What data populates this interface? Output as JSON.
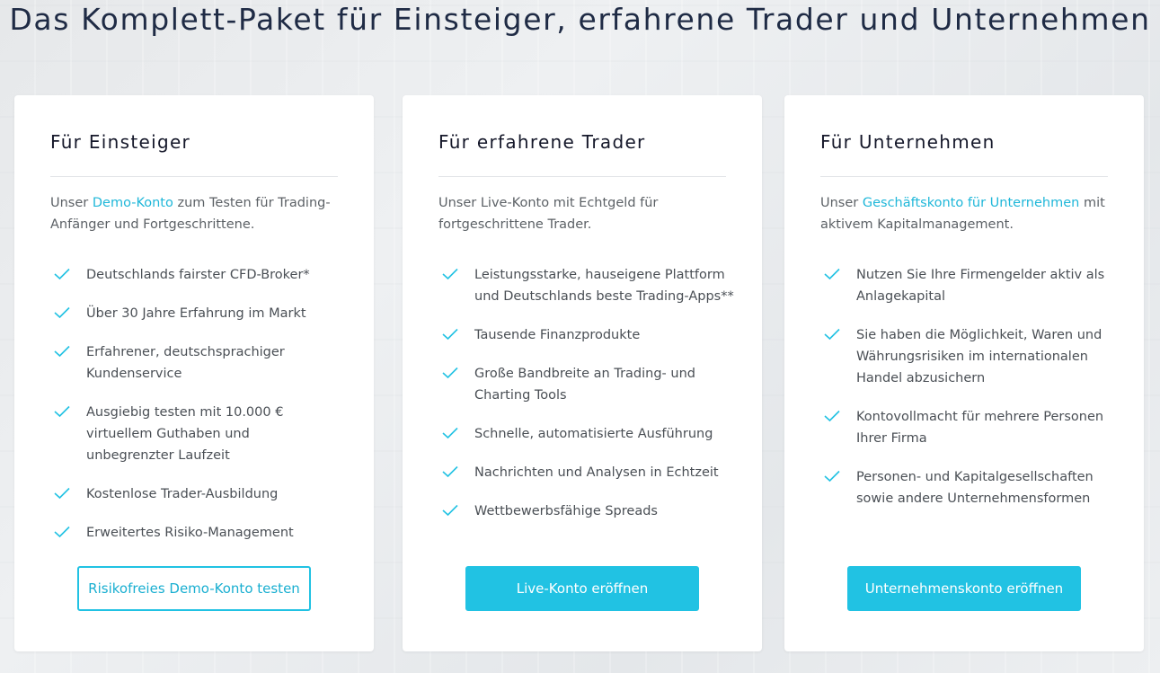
{
  "headline": "Das Komplett-Paket für Einsteiger, erfahrene Trader und Unternehmen",
  "colors": {
    "accent": "#21c2e3",
    "link": "#1fb7d9",
    "headline": "#1f2b45"
  },
  "cards": [
    {
      "title": "Für Einsteiger",
      "desc_prefix": "Unser ",
      "desc_link": "Demo-Konto",
      "desc_suffix": " zum Testen für Trading-Anfänger und Fortgeschrittene.",
      "features": [
        "Deutschlands fairster CFD-Broker*",
        "Über 30 Jahre Erfahrung im Markt",
        "Erfahrener, deutschsprachiger Kundenservice",
        "Ausgiebig testen mit 10.000 € virtuellem Guthaben und unbegrenzter Laufzeit",
        "Kostenlose Trader-Ausbildung",
        "Erweitertes Risiko-Management"
      ],
      "button": "Risikofreies Demo-Konto testen"
    },
    {
      "title": "Für erfahrene Trader",
      "desc_prefix": "Unser Live-Konto mit Echtgeld für fortgeschrittene Trader.",
      "desc_link": "",
      "desc_suffix": "",
      "features": [
        "Leistungsstarke, hauseigene Plattform und Deutschlands beste Trading-Apps**",
        "Tausende Finanzprodukte",
        "Große Bandbreite an Trading- und Charting Tools",
        "Schnelle, automatisierte Ausführung",
        "Nachrichten und Analysen in Echtzeit",
        "Wettbewerbsfähige Spreads"
      ],
      "button": "Live-Konto eröffnen"
    },
    {
      "title": "Für Unternehmen",
      "desc_prefix": "Unser ",
      "desc_link": "Geschäftskonto für Unternehmen",
      "desc_suffix": " mit aktivem Kapitalmanagement.",
      "features": [
        "Nutzen Sie Ihre Firmengelder aktiv als Anlagekapital",
        "Sie haben die Möglichkeit, Waren und Währungsrisiken im internationalen Handel abzusichern",
        "Kontovollmacht für mehrere Personen Ihrer Firma",
        "Personen- und Kapitalgesellschaften sowie andere Unternehmensformen"
      ],
      "button": "Unternehmenskonto eröffnen"
    }
  ]
}
